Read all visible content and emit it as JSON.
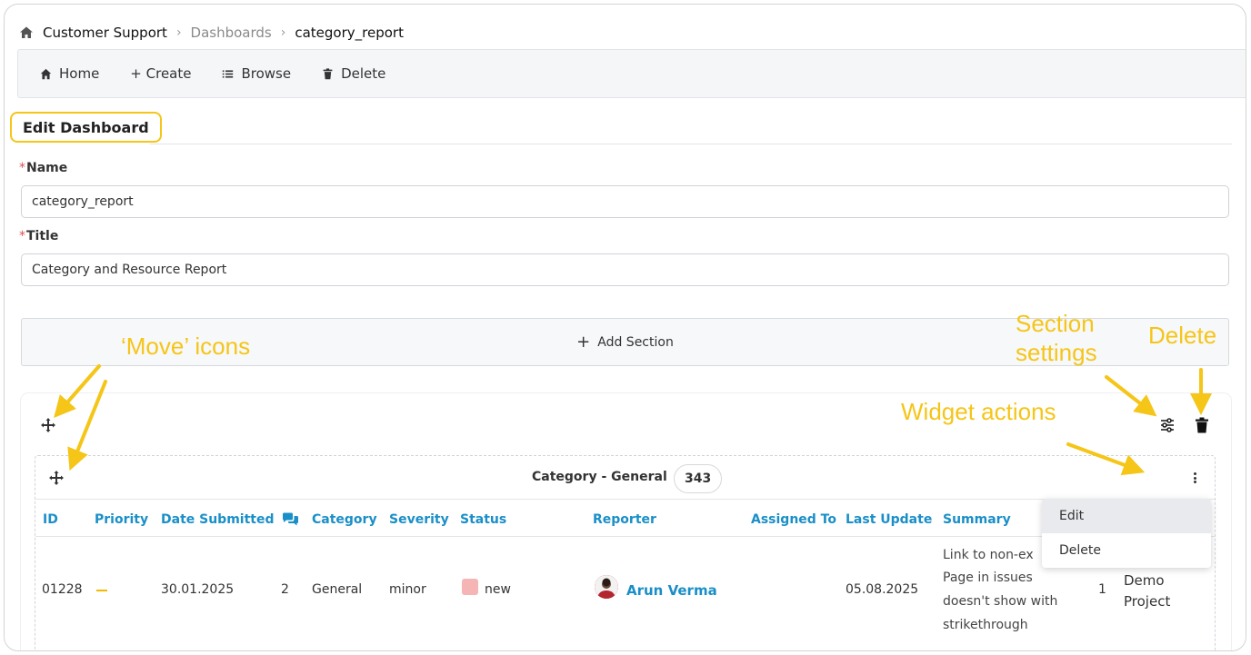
{
  "breadcrumb": {
    "home_icon": "home-icon",
    "items": [
      "Customer Support",
      "Dashboards",
      "category_report"
    ]
  },
  "toolbar": {
    "home": "Home",
    "create": "+ Create",
    "browse": "Browse",
    "delete": "Delete"
  },
  "page": {
    "heading": "Edit Dashboard"
  },
  "form": {
    "name_label": "Name",
    "name_value": "category_report",
    "title_label": "Title",
    "title_value": "Category and Resource Report",
    "required_mark": "*"
  },
  "add_section": {
    "icon": "+",
    "label": "Add Section"
  },
  "widget": {
    "title": "Category - General",
    "count": "343",
    "columns": [
      "ID",
      "Priority",
      "Date Submitted",
      "Category",
      "Severity",
      "Status",
      "Reporter",
      "Assigned To",
      "Last Update",
      "Summary"
    ],
    "notes_icon": "comments-icon",
    "row": {
      "id": "01228",
      "notes": "2",
      "date_submitted": "30.01.2025",
      "category": "General",
      "severity": "minor",
      "status": "new",
      "status_color": "#f5b5b5",
      "reporter": "Arun Verma",
      "last_update": "05.08.2025",
      "summary_lines": [
        "Link to non-ex",
        "Page in issues",
        "doesn't show with",
        "strikethrough"
      ],
      "count_col": "1",
      "project_lines": [
        "Demo",
        "Project"
      ]
    }
  },
  "widget_menu": {
    "items": [
      "Edit",
      "Delete"
    ]
  },
  "annotations": {
    "move_icons": "‘Move’ icons",
    "section_settings_1": "Section",
    "section_settings_2": "settings",
    "delete": "Delete",
    "widget_actions": "Widget actions"
  },
  "colors": {
    "accent_link": "#1a8fc7",
    "annotation": "#f5c518",
    "priority_dash": "#f5b800"
  }
}
